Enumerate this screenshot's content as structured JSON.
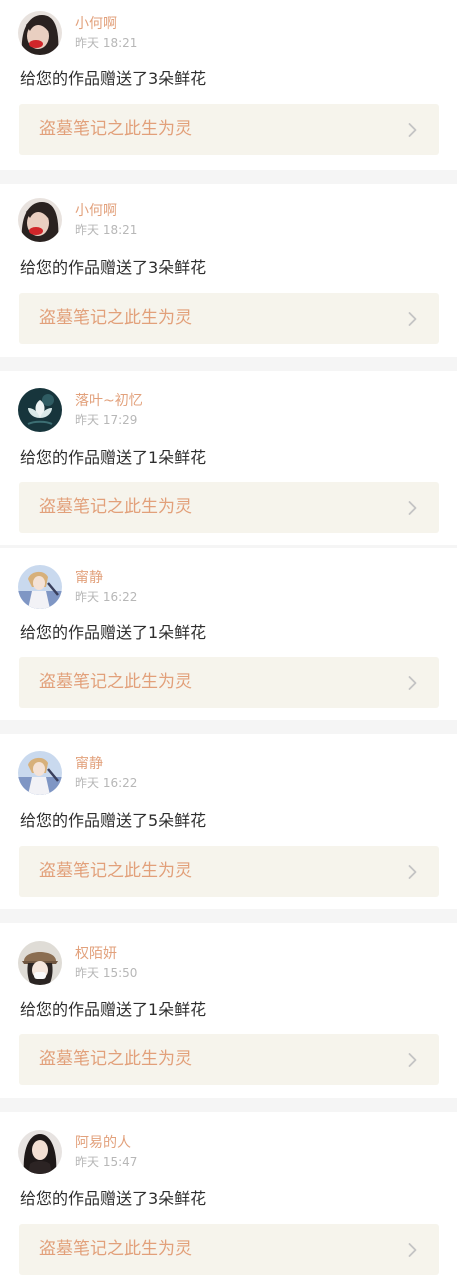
{
  "notifications": [
    {
      "user": "小何啊",
      "time": "昨天 18:21",
      "message": "给您的作品赠送了3朵鲜花",
      "work": "盗墓笔记之此生为灵",
      "avatar_icon": "girl-red-lips-avatar"
    },
    {
      "user": "小何啊",
      "time": "昨天 18:21",
      "message": "给您的作品赠送了3朵鲜花",
      "work": "盗墓笔记之此生为灵",
      "avatar_icon": "girl-red-lips-avatar"
    },
    {
      "user": "落叶~初忆",
      "time": "昨天 17:29",
      "message": "给您的作品赠送了1朵鲜花",
      "work": "盗墓笔记之此生为灵",
      "avatar_icon": "lotus-flower-avatar"
    },
    {
      "user": "甯静",
      "time": "昨天 16:22",
      "message": "给您的作品赠送了1朵鲜花",
      "work": "盗墓笔记之此生为灵",
      "avatar_icon": "anime-girl-blue-avatar"
    },
    {
      "user": "甯静",
      "time": "昨天 16:22",
      "message": "给您的作品赠送了5朵鲜花",
      "work": "盗墓笔记之此生为灵",
      "avatar_icon": "anime-girl-blue-avatar"
    },
    {
      "user": "权陌妍",
      "time": "昨天 15:50",
      "message": "给您的作品赠送了1朵鲜花",
      "work": "盗墓笔记之此生为灵",
      "avatar_icon": "girl-white-hat-avatar"
    },
    {
      "user": "阿易的人",
      "time": "昨天 15:47",
      "message": "给您的作品赠送了3朵鲜花",
      "work": "盗墓笔记之此生为灵",
      "avatar_icon": "girl-dark-hair-avatar"
    }
  ],
  "colors": {
    "username": "#e2a17c",
    "work_title": "#e2a07a",
    "work_background": "#f6f4ec",
    "message_text": "#2e2e2e",
    "time_text": "#b7b7b7",
    "separator": "#f5f5f5"
  }
}
